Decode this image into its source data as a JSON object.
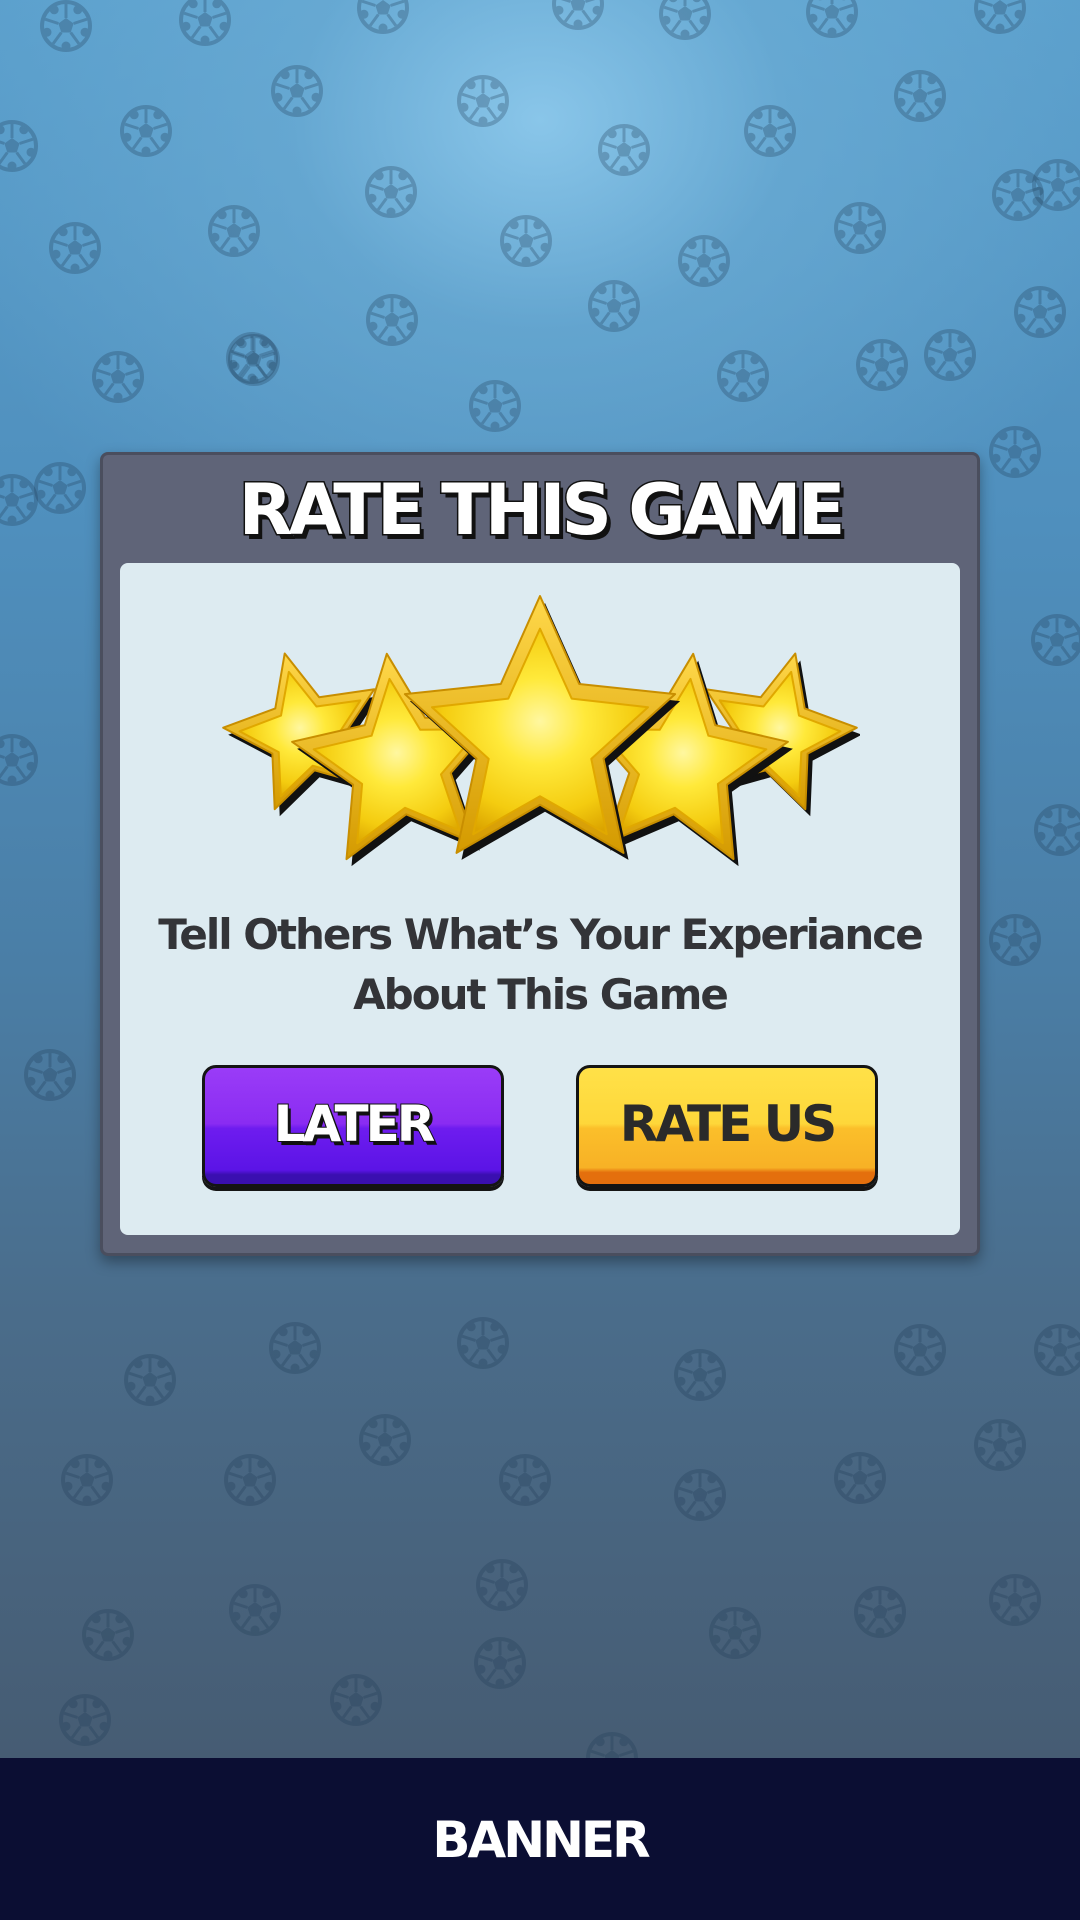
{
  "background": {
    "pattern_icon": "soccer-ball-icon",
    "colors": {
      "top": "#7ab8dc",
      "bottom": "#465c73"
    }
  },
  "dialog": {
    "title": "RATE THIS GAME",
    "rating": {
      "stars_filled": 5,
      "stars_total": 5,
      "icon": "star-icon"
    },
    "message_line1": "Tell Others What’s Your Experiance",
    "message_line2": "About This Game",
    "later_label": "LATER",
    "rate_us_label": "RATE US",
    "colors": {
      "frame": "#5f6478",
      "panel": "#ddebf1",
      "later_button": "#7a22f3",
      "rate_us_button": "#fcc532"
    }
  },
  "banner": {
    "label": "BANNER",
    "color": "#0b0e33"
  }
}
